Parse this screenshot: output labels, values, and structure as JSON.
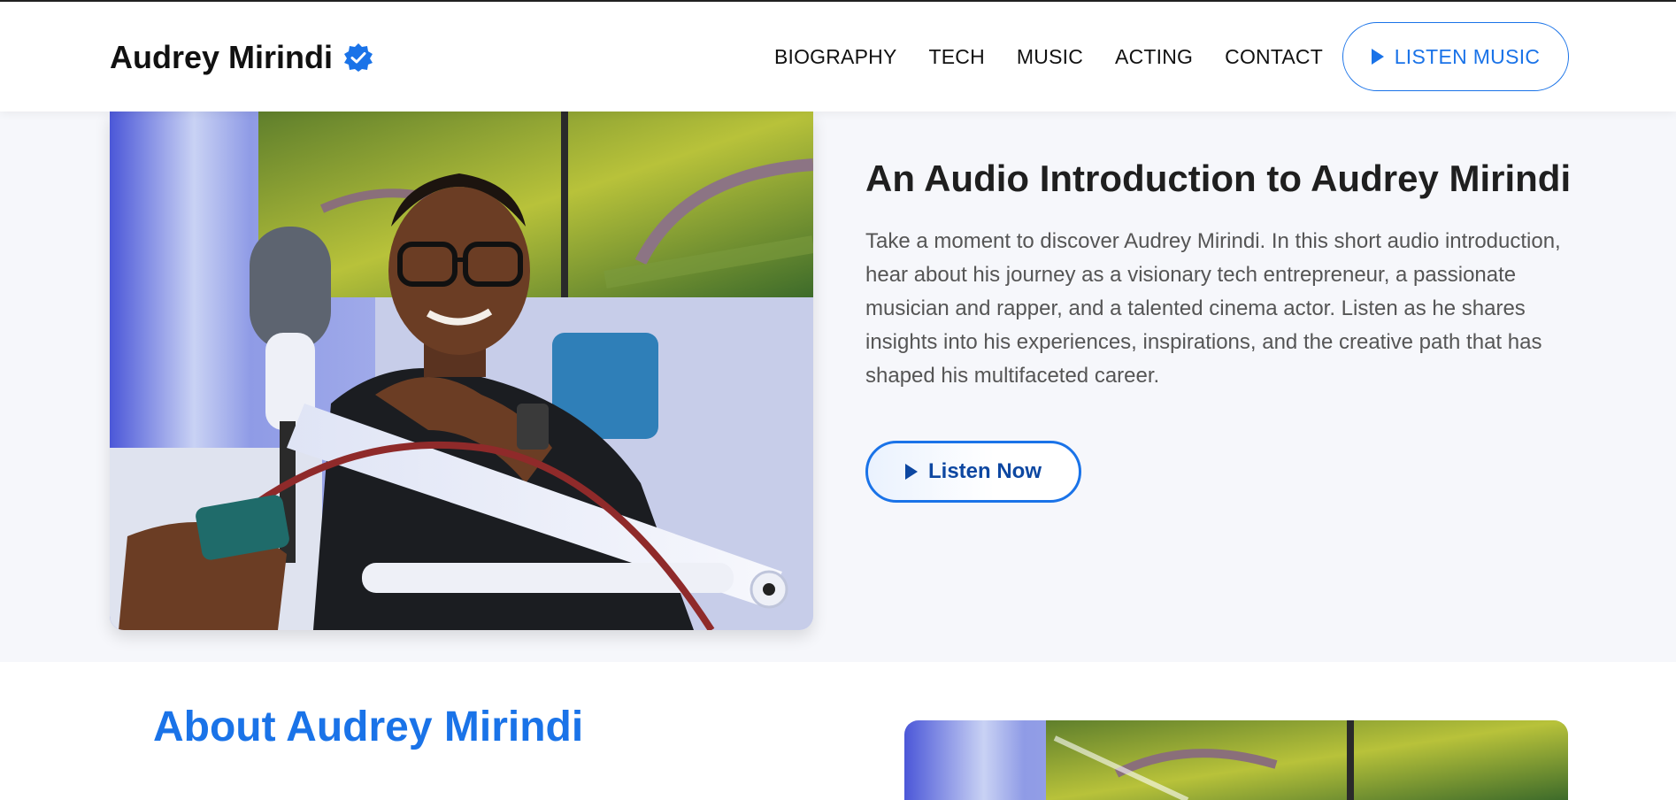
{
  "brand": {
    "name": "Audrey Mirindi",
    "verified_icon": "verified-badge-icon"
  },
  "nav": {
    "items": [
      "BIOGRAPHY",
      "TECH",
      "MUSIC",
      "ACTING",
      "CONTACT"
    ],
    "cta_label": "LISTEN MUSIC"
  },
  "hero": {
    "title": "An Audio Introduction to Audrey Mirindi",
    "text": "Take a moment to discover Audrey Mirindi. In this short audio introduction, hear about his journey as a visionary tech entrepreneur, a passionate musician and rapper, and a talented cinema actor. Listen as he shares insights into his experiences, inspirations, and the creative path that has shaped his multifaceted career.",
    "button_label": "Listen Now"
  },
  "about": {
    "title": "About Audrey Mirindi"
  },
  "colors": {
    "accent": "#1a73e8",
    "hero_bg": "#f6f7fb",
    "title_dark": "#1f1f1f"
  }
}
